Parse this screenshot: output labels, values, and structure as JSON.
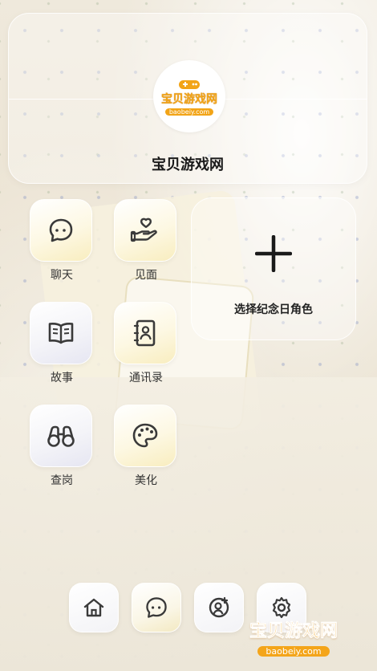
{
  "profile": {
    "name": "宝贝游戏网",
    "logo_text": "宝贝游戏网",
    "logo_sub": "baobeiy.com"
  },
  "apps": [
    {
      "label": "聊天",
      "icon": "chat-bubble-icon"
    },
    {
      "label": "见面",
      "icon": "hand-heart-icon"
    },
    {
      "label": "故事",
      "icon": "book-open-icon"
    },
    {
      "label": "通讯录",
      "icon": "contact-book-icon"
    },
    {
      "label": "查岗",
      "icon": "binoculars-icon"
    },
    {
      "label": "美化",
      "icon": "palette-icon"
    }
  ],
  "anniversary": {
    "label": "选择纪念日角色",
    "icon": "plus-icon"
  },
  "dock": [
    {
      "icon": "home-icon"
    },
    {
      "icon": "chat-bubble-icon"
    },
    {
      "icon": "add-contact-icon"
    },
    {
      "icon": "settings-icon"
    }
  ],
  "watermark": {
    "main": "宝贝游戏网",
    "sub": "baobeiy.com"
  },
  "colors": {
    "icon_stroke": "#3a3a3a",
    "brand_orange": "#f4a51a"
  }
}
